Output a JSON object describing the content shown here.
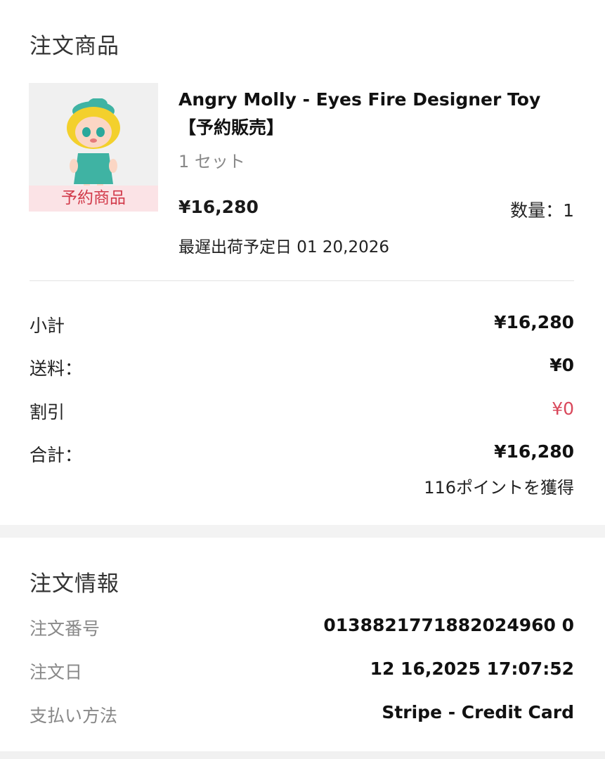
{
  "order_items": {
    "section_title": "注文商品",
    "product": {
      "badge": "予約商品",
      "title": "Angry Molly - Eyes Fire Designer Toy【予約販売】",
      "unit": "1 セット",
      "price": "¥16,280",
      "quantity": "数量：1",
      "latest_ship_date": "最遅出荷予定日 01 20,2026"
    },
    "summary": {
      "subtotal_label": "小計",
      "subtotal_value": "¥16,280",
      "shipping_label": "送料：",
      "shipping_value": "¥0",
      "discount_label": "割引",
      "discount_value": "¥0",
      "total_label": "合計：",
      "total_value": "¥16,280",
      "points_earned": "116ポイントを獲得"
    }
  },
  "order_info": {
    "section_title": "注文情報",
    "order_number_label": "注文番号",
    "order_number_value": "0138821771882024960 0",
    "order_date_label": "注文日",
    "order_date_value": "12 16,2025 17:07:52",
    "payment_method_label": "支払い方法",
    "payment_method_value": "Stripe - Credit Card"
  },
  "colors": {
    "accent_red": "#d9485b",
    "badge_bg": "#fbe3e6",
    "muted_text": "#888888"
  }
}
